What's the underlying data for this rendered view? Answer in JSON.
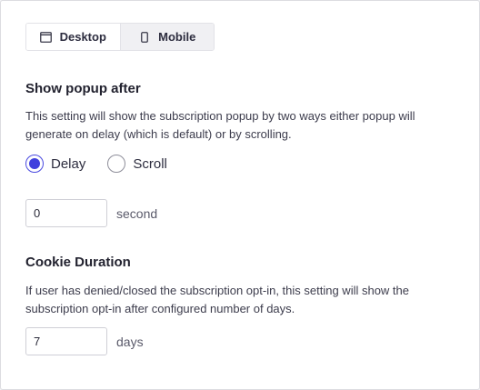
{
  "tabs": [
    {
      "label": "Desktop",
      "icon": "monitor-icon",
      "active": true
    },
    {
      "label": "Mobile",
      "icon": "phone-icon",
      "active": false
    }
  ],
  "popup": {
    "heading": "Show popup after",
    "description": "This setting will show the subscription popup by two ways either popup will generate on delay (which is default) or by scrolling.",
    "options": [
      {
        "label": "Delay",
        "checked": true
      },
      {
        "label": "Scroll",
        "checked": false
      }
    ],
    "delay_value": "0",
    "delay_unit": "second"
  },
  "cookie": {
    "heading": "Cookie Duration",
    "description": "If user has denied/closed the subscription opt-in, this setting will show the subscription opt-in after configured number of days.",
    "value": "7",
    "unit": "days"
  },
  "colors": {
    "accent": "#4040dd",
    "border": "#dcdce0"
  }
}
